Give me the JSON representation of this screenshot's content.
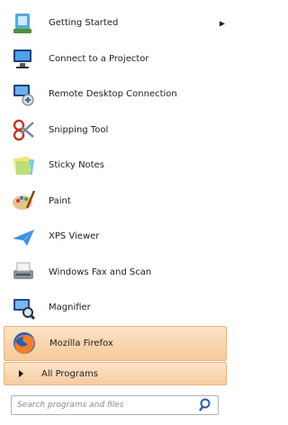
{
  "programs": [
    {
      "label": "Getting Started",
      "icon": "getting-started-icon",
      "has_submenu": true
    },
    {
      "label": "Connect to a Projector",
      "icon": "projector-icon"
    },
    {
      "label": "Remote Desktop Connection",
      "icon": "remote-desktop-icon"
    },
    {
      "label": "Snipping Tool",
      "icon": "scissors-icon"
    },
    {
      "label": "Sticky Notes",
      "icon": "sticky-notes-icon"
    },
    {
      "label": "Paint",
      "icon": "paint-palette-icon"
    },
    {
      "label": "XPS Viewer",
      "icon": "xps-viewer-icon"
    },
    {
      "label": "Windows Fax and Scan",
      "icon": "fax-scan-icon"
    },
    {
      "label": "Magnifier",
      "icon": "magnifier-icon"
    },
    {
      "label": "Mozilla Firefox",
      "icon": "firefox-icon",
      "highlighted": true
    }
  ],
  "all_programs": {
    "label": "All Programs"
  },
  "search": {
    "placeholder": "Search programs and files",
    "icon": "search-icon"
  },
  "colors": {
    "highlight": "#f7c99a",
    "highlight_border": "#e9b47c"
  }
}
